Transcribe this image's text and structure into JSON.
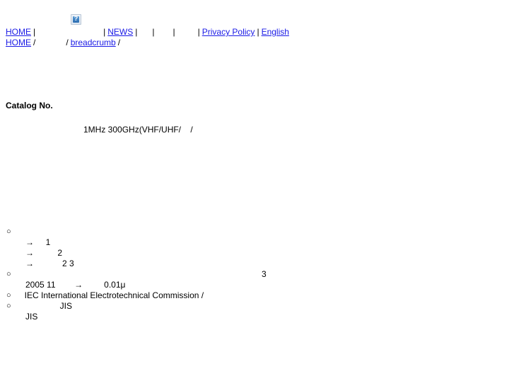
{
  "page": {
    "background": "#ffffff",
    "link_color": "#1a1ae6",
    "text_color": "#000000"
  },
  "logo": {
    "alt_glyph": "?",
    "name": "broken-image-placeholder"
  },
  "nav": {
    "items": [
      {
        "label": "HOME",
        "blank": false
      },
      {
        "label": "",
        "blank": true,
        "width": "long"
      },
      {
        "label": "NEWS",
        "blank": false
      },
      {
        "label": "",
        "blank": true,
        "width": "s1"
      },
      {
        "label": "",
        "blank": true,
        "width": "s2"
      },
      {
        "label": "",
        "blank": true,
        "width": "s3"
      },
      {
        "label": "Privacy Policy",
        "blank": false
      },
      {
        "label": "English",
        "blank": false
      }
    ],
    "separator": "|"
  },
  "breadcrumb": {
    "separator": "/",
    "items": [
      {
        "label": "HOME",
        "blank": false
      },
      {
        "label": "",
        "blank": true,
        "width": "mid"
      },
      {
        "label": "breadcrumb",
        "blank": false
      }
    ],
    "trailing": "/"
  },
  "content": {
    "catalog_heading": "Catalog No.",
    "spec_line": "1MHz 300GHz(VHF/UHF/    /",
    "bullets": [
      {
        "marker": "○",
        "text": "",
        "right_note": "",
        "subitems": [
          {
            "arrow": "→",
            "text": "     1"
          },
          {
            "arrow": "→",
            "text": "          2"
          },
          {
            "arrow": "→",
            "text": "            2 3"
          }
        ]
      },
      {
        "marker": "○",
        "text": "",
        "right_note": "3",
        "subitems": [
          {
            "arrow": "",
            "text": "2005 11        →         0.01μ"
          }
        ]
      },
      {
        "marker": "○",
        "text": "  IEC International Electrotechnical Commission /",
        "right_note": "",
        "subitems": []
      },
      {
        "marker": "○",
        "text": "                 JIS",
        "right_note": "",
        "subitems": [
          {
            "arrow": "",
            "text": "JIS"
          }
        ]
      }
    ],
    "footer_clipped": "   "
  }
}
